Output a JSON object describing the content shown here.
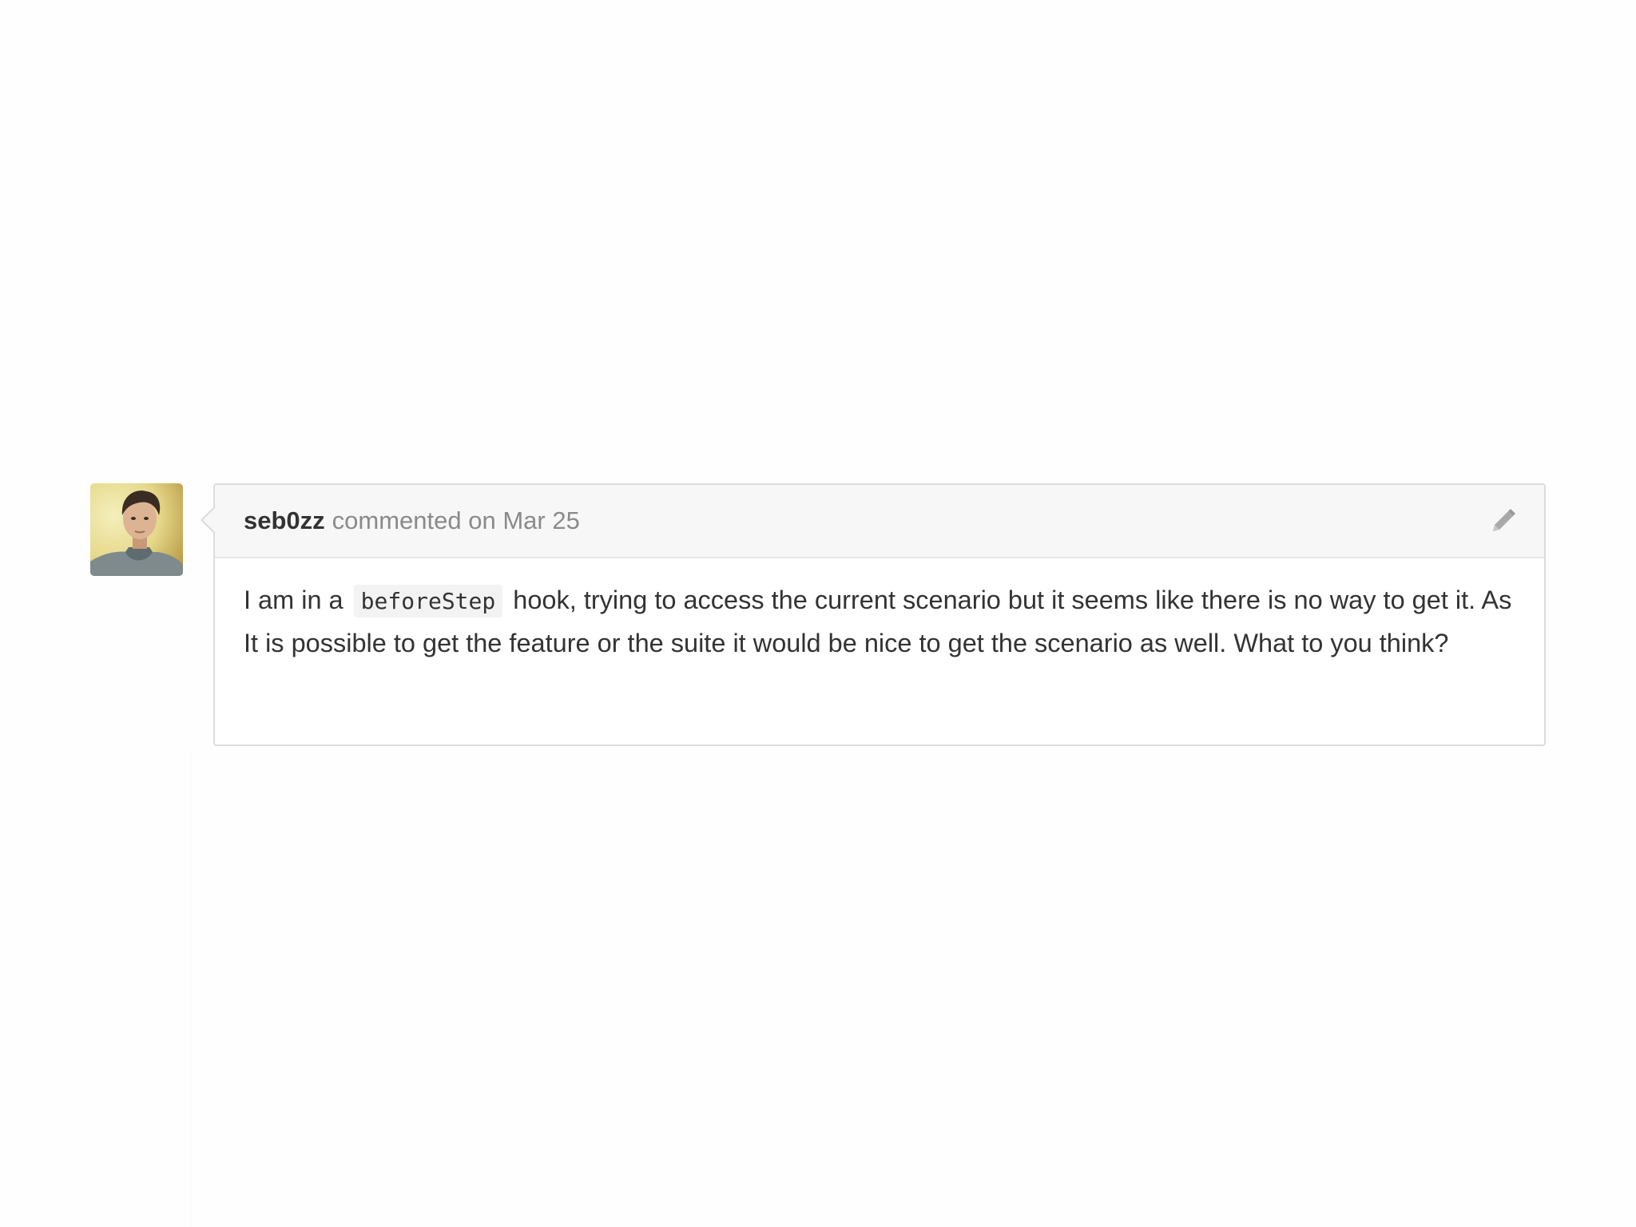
{
  "comment": {
    "author": "seb0zz",
    "action": "commented on Mar 25",
    "edit_icon": "pencil-icon",
    "avatar_icon": "user-avatar-photo",
    "body": {
      "before_code": "I am in a",
      "code": "beforeStep",
      "after_code": "hook, trying to access the current scenario but it seems like there is no way to get it. As It is possible to get the feature or the suite it would be nice to get the scenario as well. What to you think?"
    }
  },
  "colors": {
    "author_text": "#333333",
    "meta_text": "#8a8a8a",
    "header_bg": "#f7f7f7",
    "border": "#dcdcdc",
    "code_bg": "#f3f3f3"
  }
}
